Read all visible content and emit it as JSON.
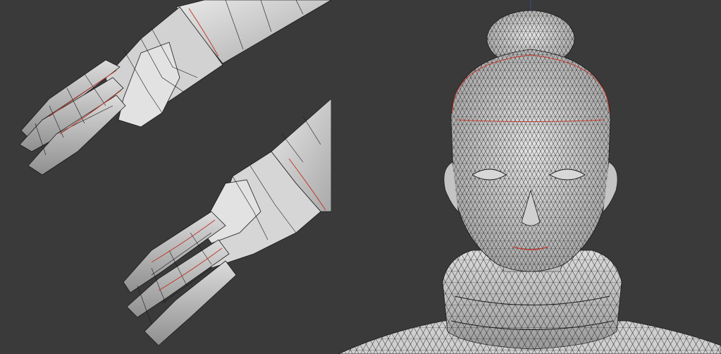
{
  "app": {
    "kind": "3d-modeling-viewport",
    "mode": "edit-wireframe-overlay"
  },
  "colors": {
    "viewport_bg": "#3a3a3a",
    "mesh_fill": "#c9c9c9",
    "mesh_fill_light": "#e4e4e4",
    "mesh_fill_dark": "#8d8d8d",
    "wire": "#1a1a1a",
    "seam": "#c0392b",
    "axis_line": "#3b4f8c"
  },
  "viewports": [
    {
      "id": "hands",
      "objects": [
        "upper-hand-mesh",
        "lower-hand-mesh"
      ],
      "icon": "hand-mesh-icon"
    },
    {
      "id": "head",
      "objects": [
        "head-mesh",
        "scarf-mesh",
        "torso-mesh"
      ],
      "icon": "head-mesh-icon"
    }
  ]
}
